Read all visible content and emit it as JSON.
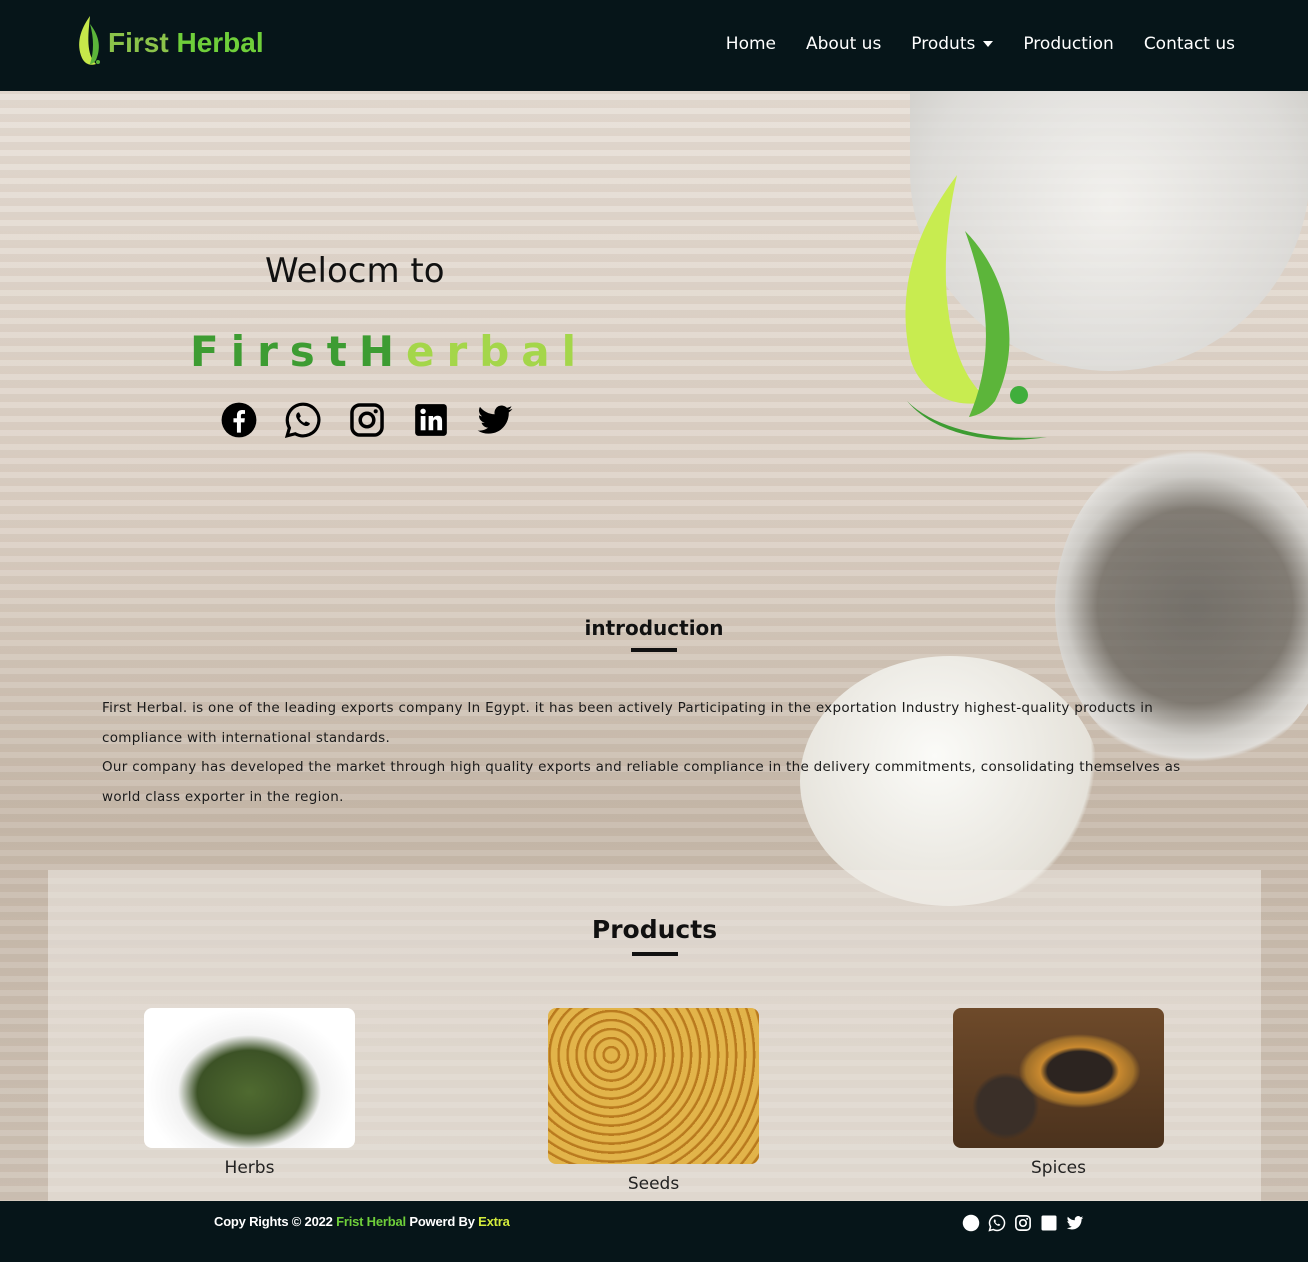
{
  "nav": {
    "logo_text_1": "First",
    "logo_text_2": "Herbal",
    "items": [
      "Home",
      "About us",
      "Produts",
      "Production",
      "Contact us"
    ]
  },
  "hero": {
    "welcome": "Welocm to",
    "brand_1": "First",
    "brand_2": "H",
    "brand_3": "erbal",
    "social": [
      "facebook-icon",
      "whatsapp-icon",
      "instagram-icon",
      "linkedin-icon",
      "twitter-icon"
    ]
  },
  "intro": {
    "title": "introduction",
    "p1": "First Herbal. is one of the leading exports company In Egypt. it has been actively Participating in the exportation Industry highest-quality products in compliance with international standards.",
    "p2": "Our company has developed the market through high quality exports and reliable compliance in the delivery commitments, consolidating themselves as world class exporter in the region."
  },
  "products": {
    "title": "Products",
    "items": [
      "Herbs",
      "Seeds",
      "Spices"
    ]
  },
  "footer": {
    "t1": "Copy Rights © 2022 ",
    "t2": "Frist Herbal",
    "t3": " Powerd By ",
    "t4": "Extra"
  },
  "colors": {
    "nav_bg": "#061519",
    "green_light": "#a4d64a",
    "green_dark": "#3d9c32"
  }
}
